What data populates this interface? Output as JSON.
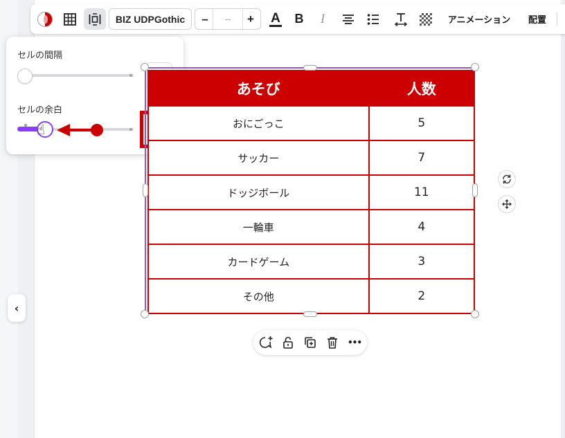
{
  "toolbar": {
    "font_name": "BIZ UDPGothic",
    "font_size_decrease": "–",
    "font_size_value": "--",
    "font_size_increase": "+",
    "text_color_letter": "A",
    "bold_letter": "B",
    "italic_letter": "I",
    "animation_label": "アニメーション",
    "arrange_label": "配置",
    "accent_color": "#cc0000",
    "active_tool": "cell-spacing"
  },
  "spacing_panel": {
    "cell_gap_label": "セルの間隔",
    "cell_gap_value": "0",
    "cell_padding_label": "セルの余白",
    "cell_padding_value": "4",
    "slider_accent": "#8b3dff",
    "annotation_color": "#cc0000"
  },
  "table": {
    "headers": [
      "あそび",
      "人数"
    ],
    "rows": [
      [
        "おにごっこ",
        "5"
      ],
      [
        "サッカー",
        "7"
      ],
      [
        "ドッジボール",
        "11"
      ],
      [
        "一輪車",
        "4"
      ],
      [
        "カードゲーム",
        "3"
      ],
      [
        "その他",
        "2"
      ]
    ],
    "header_bg": "#cc0000",
    "border_color": "#cc0000",
    "selection_color": "#a24fc9"
  },
  "collapse_button": {
    "glyph": "‹"
  },
  "floating_toolbar": {
    "icons": [
      "comment-add-icon",
      "lock-icon",
      "duplicate-icon",
      "trash-icon",
      "more-icon"
    ],
    "more_glyph": "•••"
  }
}
